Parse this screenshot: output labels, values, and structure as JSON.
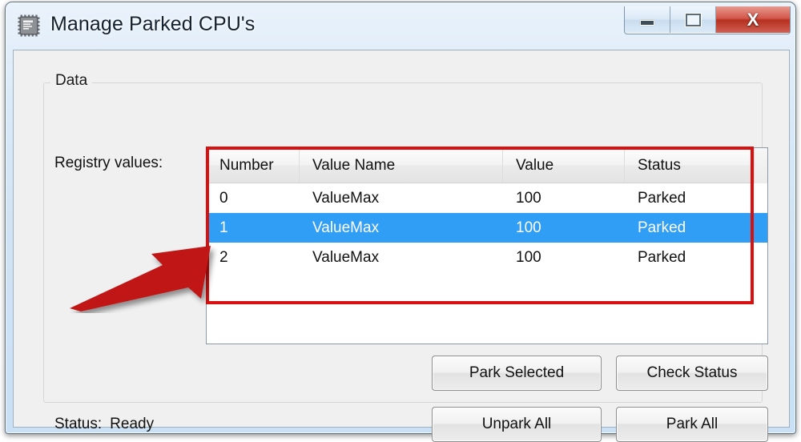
{
  "window": {
    "title": "Manage Parked CPU's",
    "icon": "cpu-chip-icon",
    "controls": {
      "minimize": "minimize-icon",
      "maximize": "maximize-icon",
      "close": "X"
    }
  },
  "groupbox": {
    "title": "Data",
    "registry_label": "Registry values:"
  },
  "listview": {
    "columns": [
      "Number",
      "Value Name",
      "Value",
      "Status"
    ],
    "rows": [
      {
        "number": "0",
        "value_name": "ValueMax",
        "value": "100",
        "status": "Parked",
        "selected": false
      },
      {
        "number": "1",
        "value_name": "ValueMax",
        "value": "100",
        "status": "Parked",
        "selected": true
      },
      {
        "number": "2",
        "value_name": "ValueMax",
        "value": "100",
        "status": "Parked",
        "selected": false
      }
    ]
  },
  "buttons": {
    "park_selected": "Park Selected",
    "check_status": "Check Status",
    "unpark_all": "Unpark All",
    "park_all": "Park All"
  },
  "status": {
    "label": "Status:",
    "value": "Ready"
  },
  "annotations": {
    "highlight_rect_color": "#d81010",
    "arrow_color": "#c11414",
    "arrow_name": "red-pointer-arrow"
  },
  "colors": {
    "selection_blue": "#2f9ef4",
    "titlebar_blue": "#cfe3f6",
    "client_gray": "#f0f0f0",
    "close_red": "#b6301f"
  }
}
